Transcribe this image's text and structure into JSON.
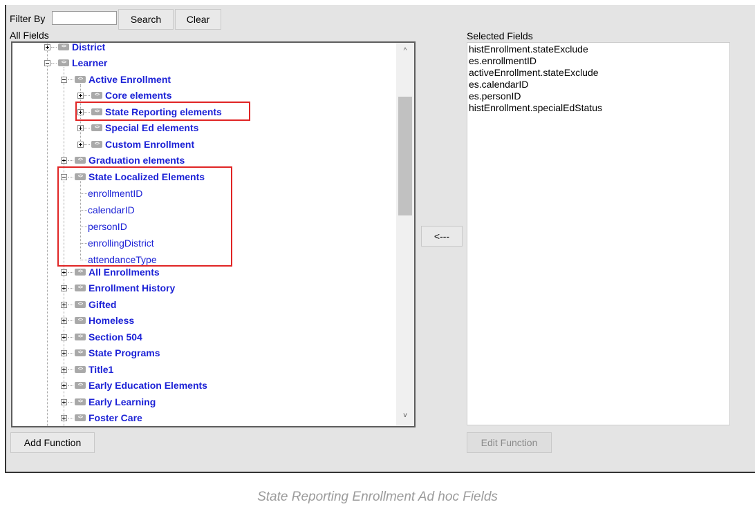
{
  "filter": {
    "label": "Filter By",
    "value": "",
    "search_label": "Search",
    "clear_label": "Clear"
  },
  "all_fields": {
    "heading": "All Fields",
    "rows": [
      {
        "label": "District",
        "toggle": "plus",
        "kind": "folder"
      },
      {
        "label": "Learner",
        "toggle": "minus",
        "kind": "folder"
      },
      {
        "label": "Active Enrollment",
        "toggle": "minus",
        "kind": "folder"
      },
      {
        "label": "Core elements",
        "toggle": "plus",
        "kind": "folder"
      },
      {
        "label": "State Reporting elements",
        "toggle": "plus",
        "kind": "folder"
      },
      {
        "label": "Special Ed elements",
        "toggle": "plus",
        "kind": "folder"
      },
      {
        "label": "Custom Enrollment",
        "toggle": "plus",
        "kind": "folder"
      },
      {
        "label": "Graduation elements",
        "toggle": "plus",
        "kind": "folder"
      },
      {
        "label": "State Localized Elements",
        "toggle": "minus",
        "kind": "folder"
      },
      {
        "label": "enrollmentID",
        "kind": "field"
      },
      {
        "label": "calendarID",
        "kind": "field"
      },
      {
        "label": "personID",
        "kind": "field"
      },
      {
        "label": "enrollingDistrict",
        "kind": "field"
      },
      {
        "label": "attendanceType",
        "kind": "field"
      },
      {
        "label": "All Enrollments",
        "toggle": "plus",
        "kind": "folder"
      },
      {
        "label": "Enrollment History",
        "toggle": "plus",
        "kind": "folder"
      },
      {
        "label": "Gifted",
        "toggle": "plus",
        "kind": "folder"
      },
      {
        "label": "Homeless",
        "toggle": "plus",
        "kind": "folder"
      },
      {
        "label": "Section 504",
        "toggle": "plus",
        "kind": "folder"
      },
      {
        "label": "State Programs",
        "toggle": "plus",
        "kind": "folder"
      },
      {
        "label": "Title1",
        "toggle": "plus",
        "kind": "folder"
      },
      {
        "label": "Early Education Elements",
        "toggle": "plus",
        "kind": "folder"
      },
      {
        "label": "Early Learning",
        "toggle": "plus",
        "kind": "folder"
      },
      {
        "label": "Foster Care",
        "toggle": "plus",
        "kind": "folder"
      }
    ],
    "folder_icon_glyph": "<>",
    "scroll_up_glyph": "^",
    "scroll_down_glyph": "v"
  },
  "move_left_label": "<---",
  "selected_fields": {
    "heading": "Selected Fields",
    "items": [
      "histEnrollment.stateExclude",
      "es.enrollmentID",
      "activeEnrollment.stateExclude",
      "es.calendarID",
      "es.personID",
      "histEnrollment.specialEdStatus"
    ]
  },
  "add_function_label": "Add Function",
  "edit_function_label": "Edit Function",
  "caption": "State Reporting Enrollment Ad hoc Fields",
  "colors": {
    "link": "#1c22d6",
    "highlight": "#e02424",
    "panel": "#e4e4e4"
  }
}
